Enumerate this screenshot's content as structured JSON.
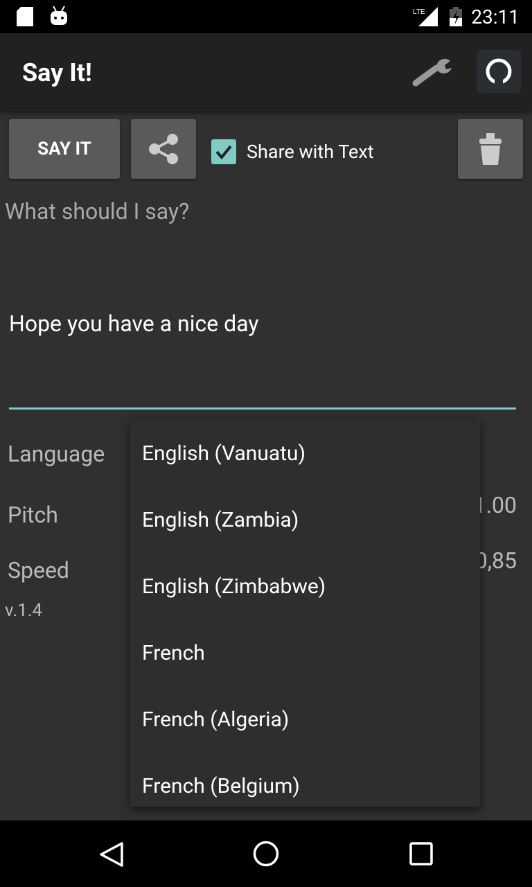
{
  "status_bar": {
    "time": "23:11",
    "network": "LTE"
  },
  "app_bar": {
    "title": "Say It!"
  },
  "toolbar": {
    "say_label": "SAY IT",
    "share_with_text_label": "Share with Text",
    "share_with_text_checked": true
  },
  "input": {
    "placeholder": "What should I say?",
    "value": "Hope you have a nice day"
  },
  "settings": {
    "language_label": "Language",
    "pitch_label": "Pitch",
    "pitch_value": "1.00",
    "speed_label": "Speed",
    "speed_value": "0,85"
  },
  "version": "v.1.4",
  "dropdown": {
    "options": [
      "English (Vanuatu)",
      "English (Zambia)",
      "English (Zimbabwe)",
      "French",
      "French (Algeria)",
      "French (Belgium)"
    ]
  },
  "colors": {
    "accent": "#80cbc4"
  }
}
